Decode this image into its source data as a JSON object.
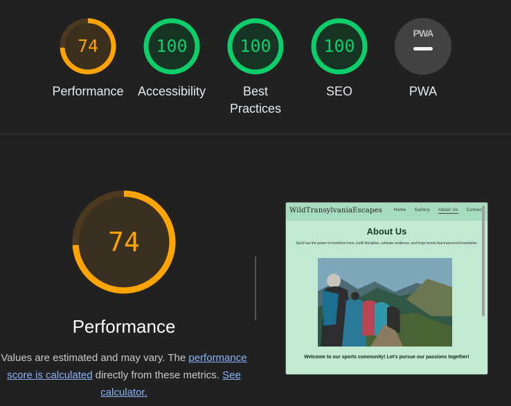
{
  "summary_scores": [
    {
      "label": "Performance",
      "value": "74",
      "progress": 0.74,
      "status_color": "#ffa400",
      "track_color": "#4b3a1f"
    },
    {
      "label": "Accessibility",
      "value": "100",
      "progress": 1,
      "status_color": "#0cce6b",
      "track_color": "#0c3b1f"
    },
    {
      "label": "Best Practices",
      "value": "100",
      "progress": 1,
      "status_color": "#0cce6b",
      "track_color": "#0c3b1f"
    },
    {
      "label": "SEO",
      "value": "100",
      "progress": 1,
      "status_color": "#0cce6b",
      "track_color": "#0c3b1f"
    },
    {
      "label": "PWA",
      "logo": "PWA",
      "status": "not applicable"
    }
  ],
  "performance": {
    "score": "74",
    "progress": 0.74,
    "title": "Performance",
    "status_color": "#ffa400",
    "summary": {
      "part1": "Values are estimated and may vary. The ",
      "link1": "performance score is calculated",
      "part2": " directly from these metrics. ",
      "link2": "See calculator."
    }
  },
  "preview": {
    "brand": "WildTransylvaniaEscapes",
    "nav_links": [
      "Home",
      "Gallery",
      "About Us",
      "Contact"
    ],
    "heading": "About Us",
    "intro": "Sport has the power to transform lives, instill discipline, cultivate resilience, and forge bonds that transcend boundaries",
    "welcome": "Welcome to our sports community! Let's pursue our passions together!",
    "photo_icon": "hikers-photo"
  }
}
